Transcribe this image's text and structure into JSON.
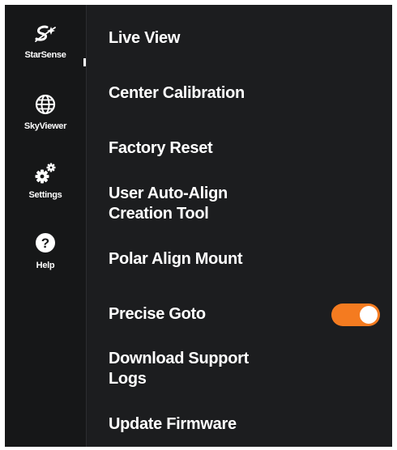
{
  "rail": {
    "items": [
      {
        "label": "StarSense",
        "icon": "starsense-icon"
      },
      {
        "label": "SkyViewer",
        "icon": "globe-icon"
      },
      {
        "label": "Settings",
        "icon": "gears-icon"
      },
      {
        "label": "Help",
        "icon": "help-icon"
      }
    ]
  },
  "menu": {
    "items": [
      {
        "label": "Live View"
      },
      {
        "label": "Center Calibration"
      },
      {
        "label": "Factory Reset"
      },
      {
        "line1": "User Auto-Align",
        "line2": "Creation Tool"
      },
      {
        "label": "Polar Align Mount"
      },
      {
        "label": "Precise Goto",
        "toggle_on": true
      },
      {
        "line1": "Download Support",
        "line2": "Logs"
      },
      {
        "label": "Update Firmware"
      }
    ]
  },
  "colors": {
    "background": "#161718",
    "panel": "#1c1d1f",
    "accent": "#f47b20",
    "text": "#ffffff"
  }
}
